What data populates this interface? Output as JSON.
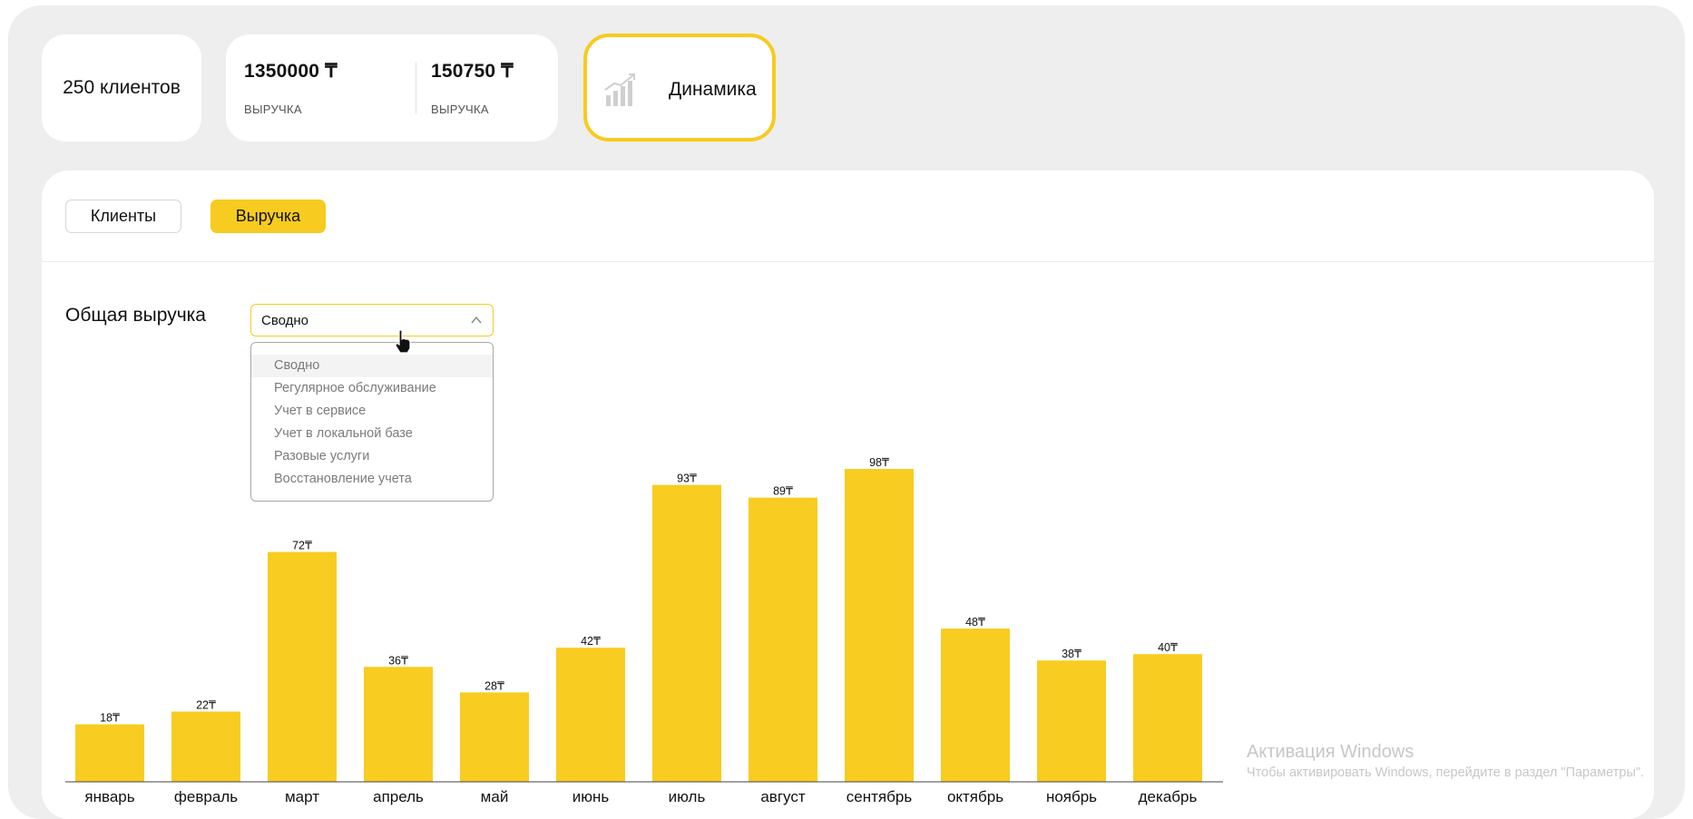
{
  "summary": {
    "clients": "250 клиентов",
    "revenue_1": {
      "amount": "1350000 ₸",
      "label": "ВЫРУЧКА"
    },
    "revenue_2": {
      "amount": "150750 ₸",
      "label": "ВЫРУЧКА"
    },
    "dynamics": {
      "label": "Динамика",
      "icon": "bar-chart-growth-icon"
    }
  },
  "tabs": [
    {
      "label": "Клиенты",
      "active": false
    },
    {
      "label": "Выручка",
      "active": true
    }
  ],
  "section": {
    "title": "Общая выручка",
    "select_value": "Сводно",
    "options": [
      "Сводно",
      "Регулярное обслуживание",
      "Учет в сервисе",
      "Учет в локальной базе",
      "Разовые услуги",
      "Восстановление учета"
    ]
  },
  "colors": {
    "accent": "#f7cb1f",
    "bar": "#f8cc21",
    "panel": "#eeeeee"
  },
  "chart_data": {
    "type": "bar",
    "categories": [
      "январь",
      "февраль",
      "март",
      "апрель",
      "май",
      "июнь",
      "июль",
      "август",
      "сентябрь",
      "октябрь",
      "ноябрь",
      "декабрь"
    ],
    "values": [
      18,
      22,
      72,
      36,
      28,
      42,
      93,
      89,
      98,
      48,
      38,
      40
    ],
    "value_labels": [
      "18₸",
      "22₸",
      "72₸",
      "36₸",
      "28₸",
      "42₸",
      "93₸",
      "89₸",
      "98₸",
      "48₸",
      "38₸",
      "40₸"
    ],
    "ylim": [
      0,
      100
    ],
    "grid": false
  },
  "watermark": {
    "line1": "Активация Windows",
    "line2": "Чтобы активировать Windows, перейдите в раздел \"Параметры\"."
  }
}
